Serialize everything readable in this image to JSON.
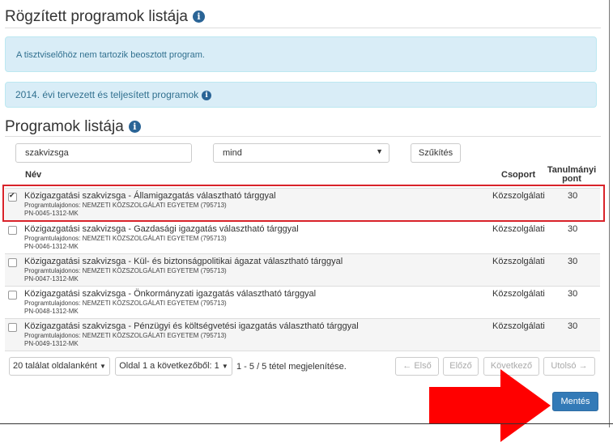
{
  "section_title": "Rögzített programok listája",
  "alert_no_program": "A tisztviselőhöz nem tartozik beosztott program.",
  "planned_title": "2014. évi tervezett és teljesített programok",
  "programs_title": "Programok listája",
  "filter": {
    "search_value": "szakvizsga",
    "select_value": "mind",
    "narrow_button": "Szűkítés"
  },
  "table": {
    "col_name": "Név",
    "col_group": "Csoport",
    "col_points": "Tanulmányi pont",
    "rows": [
      {
        "checked": true,
        "name": "Közigazgatási szakvizsga - Államigazgatás választható tárggyal",
        "owner": "Programtulajdonos: NEMZETI KÖZSZOLGÁLATI EGYETEM (795713)",
        "code": "PN-0045-1312-MK",
        "group": "Közszolgálati",
        "points": "30"
      },
      {
        "checked": false,
        "name": "Közigazgatási szakvizsga - Gazdasági igazgatás választható tárggyal",
        "owner": "Programtulajdonos: NEMZETI KÖZSZOLGÁLATI EGYETEM (795713)",
        "code": "PN-0046-1312-MK",
        "group": "Közszolgálati",
        "points": "30"
      },
      {
        "checked": false,
        "name": "Közigazgatási szakvizsga - Kül- és biztonságpolitikai ágazat választható tárggyal",
        "owner": "Programtulajdonos: NEMZETI KÖZSZOLGÁLATI EGYETEM (795713)",
        "code": "PN-0047-1312-MK",
        "group": "Közszolgálati",
        "points": "30"
      },
      {
        "checked": false,
        "name": "Közigazgatási szakvizsga - Önkormányzati igazgatás választható tárggyal",
        "owner": "Programtulajdonos: NEMZETI KÖZSZOLGÁLATI EGYETEM (795713)",
        "code": "PN-0048-1312-MK",
        "group": "Közszolgálati",
        "points": "30"
      },
      {
        "checked": false,
        "name": "Közigazgatási szakvizsga - Pénzügyi és költségvetési igazgatás választható tárggyal",
        "owner": "Programtulajdonos: NEMZETI KÖZSZOLGÁLATI EGYETEM (795713)",
        "code": "PN-0049-1312-MK",
        "group": "Közszolgálati",
        "points": "30"
      }
    ]
  },
  "pager": {
    "per_page": "20 találat oldalanként",
    "page_of": "Oldal 1 a következőből: 1",
    "info": "1 - 5 / 5 tétel megjelenítése.",
    "first": "← Első",
    "prev": "Előző",
    "next": "Következő",
    "last": "Utolsó →"
  },
  "save_button": "Mentés",
  "colors": {
    "primary": "#337ab7",
    "info_bg": "#d9edf7",
    "highlight": "#d9232a",
    "arrow": "#ff0000"
  }
}
